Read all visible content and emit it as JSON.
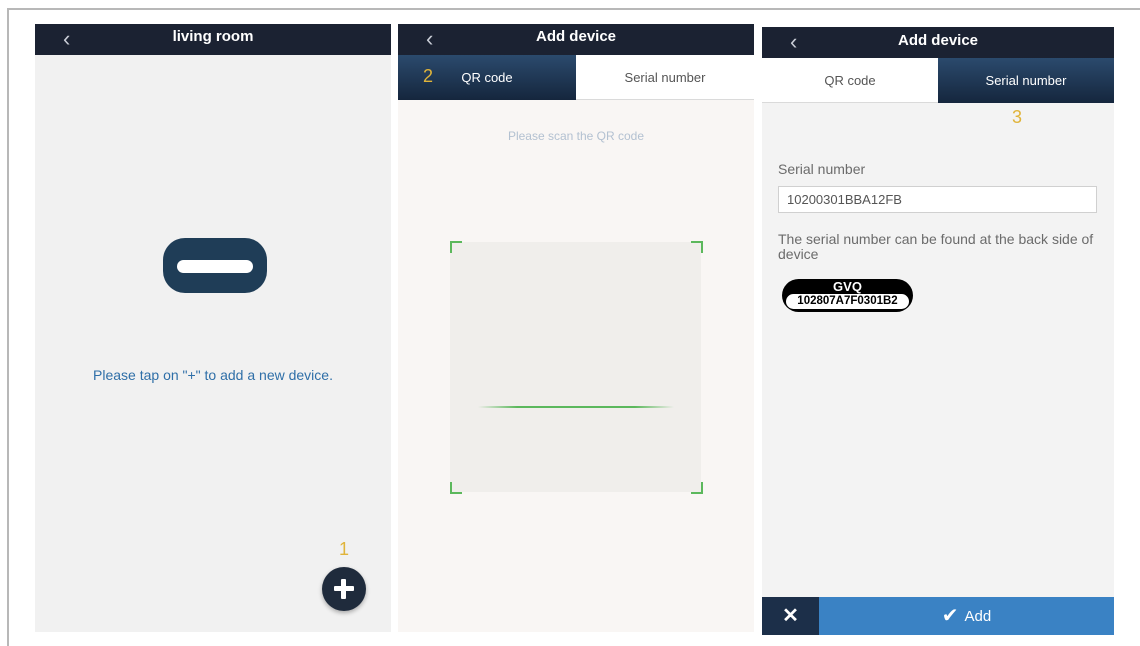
{
  "screen1": {
    "title": "living room",
    "back_icon": "chevron-left-icon",
    "hint": "Please tap on \"+\" to add a new device.",
    "step": "1",
    "add_icon": "plus-icon"
  },
  "screen2": {
    "title": "Add device",
    "step": "2",
    "tabs": [
      {
        "label": "QR code",
        "active": true
      },
      {
        "label": "Serial number",
        "active": false
      }
    ],
    "hint": "Please scan the QR code"
  },
  "screen3": {
    "title": "Add device",
    "step": "3",
    "tabs": [
      {
        "label": "QR code",
        "active": false
      },
      {
        "label": "Serial number",
        "active": true
      }
    ],
    "serial_label": "Serial number",
    "serial_value": "10200301BBA12FB",
    "help_text": "The serial number can be found at the back side of device",
    "label_brand": "GVQ",
    "label_code": "102807A7F0301B2",
    "close_icon": "close-icon",
    "add_label": "Add"
  },
  "colors": {
    "navbar": "#1b2232",
    "accent_blue": "#3a82c4",
    "active_tab": "#1f3654",
    "step_number": "#e0b43a",
    "scan_frame": "#5cb85c",
    "hint_text": "#2f6fa8"
  }
}
